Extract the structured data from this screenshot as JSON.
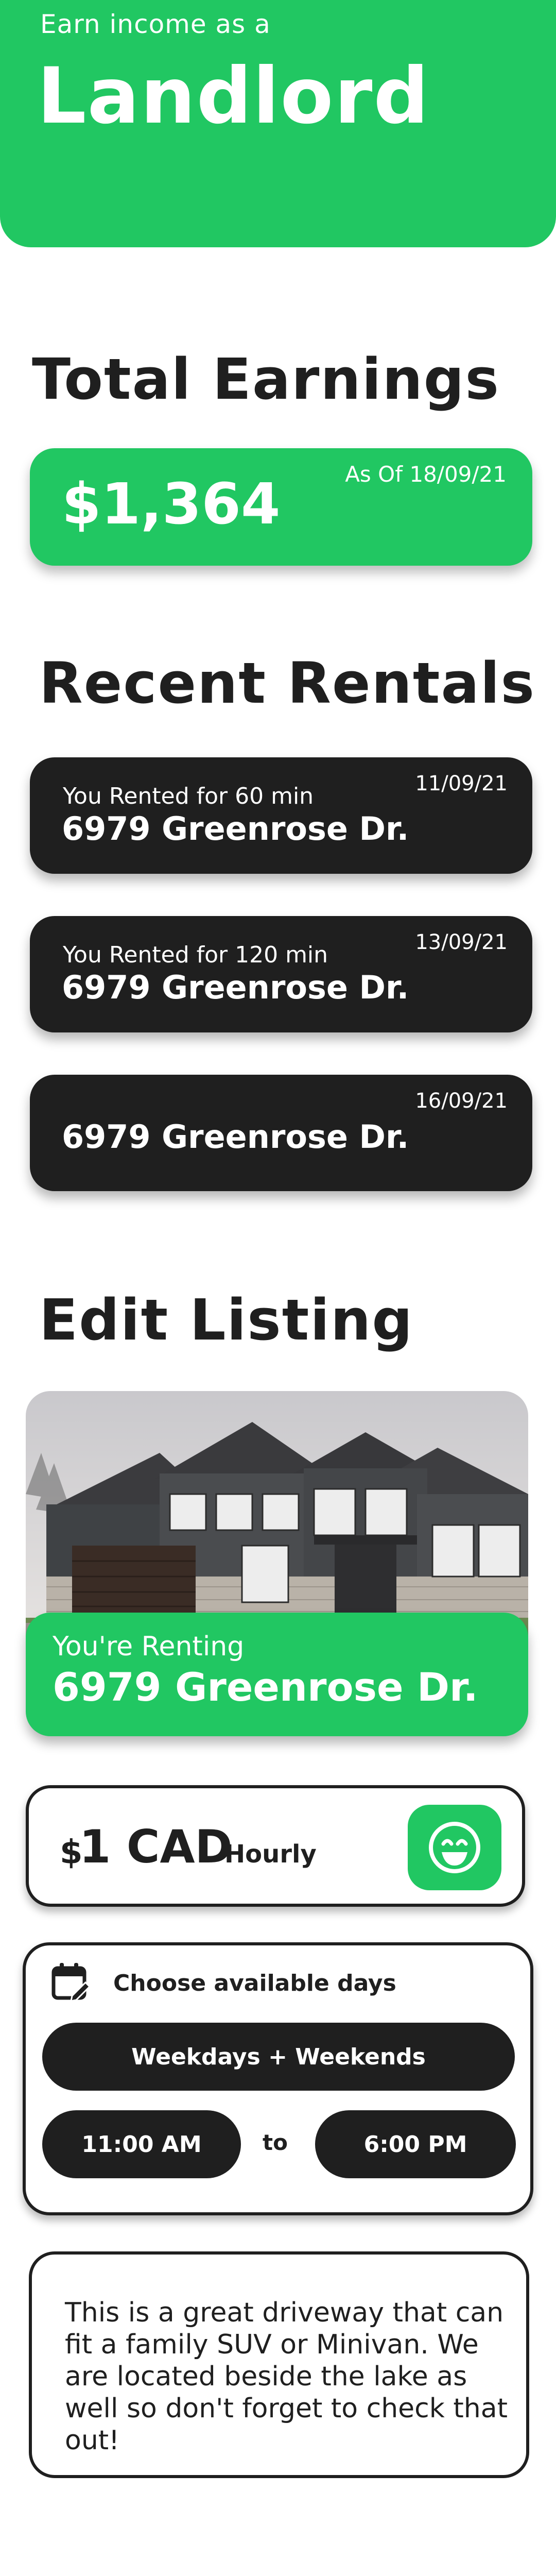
{
  "header": {
    "subtitle": "Earn income as a",
    "title": "Landlord"
  },
  "earnings": {
    "heading": "Total Earnings",
    "amount": "$1,364",
    "as_of": "As Of 18/09/21"
  },
  "recent": {
    "heading": "Recent Rentals",
    "items": [
      {
        "duration": "You Rented for 60 min",
        "address": "6979 Greenrose Dr.",
        "date": "11/09/21"
      },
      {
        "duration": "You Rented for 120 min",
        "address": "6979 Greenrose Dr.",
        "date": "13/09/21"
      },
      {
        "duration": "",
        "address": "6979 Greenrose Dr.",
        "date": "16/09/21"
      }
    ]
  },
  "listing": {
    "heading": "Edit Listing",
    "renting_label": "You're Renting",
    "address": "6979 Greenrose Dr.",
    "price_symbol": "$",
    "price_amount": "1 CAD",
    "price_unit": "Hourly",
    "availability_title": "Choose available days",
    "days_option": "Weekdays + Weekends",
    "start_time": "11:00 AM",
    "to_label": "to",
    "end_time": "6:00 PM",
    "description": "This is a great driveway that can fit a family SUV or Minivan. We are located beside the lake as well so don't forget to check that out!"
  },
  "colors": {
    "brand_green": "#21c762",
    "dark": "#1f1f1f",
    "white": "#ffffff"
  },
  "icons": {
    "smile": "smile-icon",
    "calendar_edit": "calendar-edit-icon",
    "house_photo": "house-image"
  }
}
